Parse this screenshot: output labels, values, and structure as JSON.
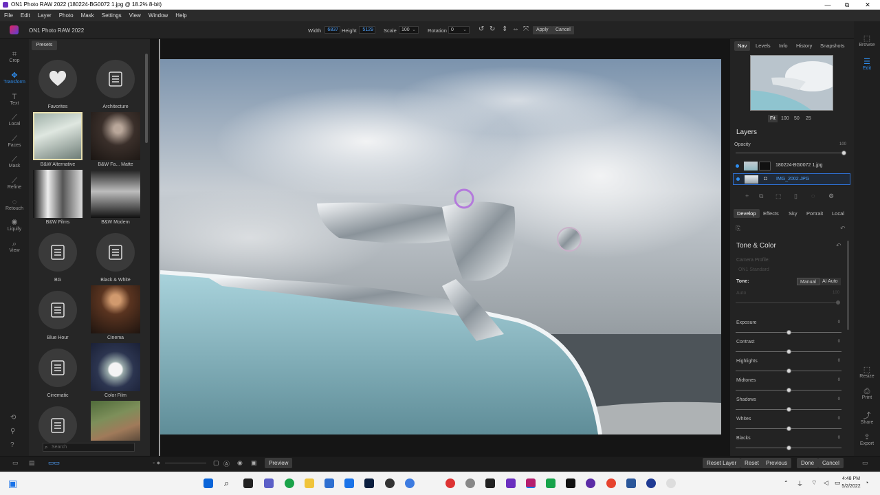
{
  "window": {
    "title": "ON1 Photo RAW 2022 (180224-BG0072 1.jpg @ 18.2% 8-bit)",
    "minimize": "—",
    "maximize": "⧉",
    "close": "✕"
  },
  "menu": [
    "File",
    "Edit",
    "Layer",
    "Photo",
    "Mask",
    "Settings",
    "View",
    "Window",
    "Help"
  ],
  "toolbar": {
    "brand": "ON1 Photo RAW 2022",
    "width_label": "Width",
    "width_value": "6837",
    "height_label": "Height",
    "height_value": "5129",
    "scale_label": "Scale",
    "scale_value": "100",
    "rotation_label": "Rotation",
    "rotation_value": "0",
    "apply": "Apply",
    "cancel": "Cancel"
  },
  "tools": [
    {
      "label": "Crop",
      "icon": "crop-icon"
    },
    {
      "label": "Transform",
      "icon": "transform-icon",
      "active": true
    },
    {
      "label": "Text",
      "icon": "text-icon"
    },
    {
      "label": "Local",
      "icon": "brush-icon"
    },
    {
      "label": "Faces",
      "icon": "faces-icon"
    },
    {
      "label": "Mask",
      "icon": "mask-icon"
    },
    {
      "label": "Refine",
      "icon": "refine-icon"
    },
    {
      "label": "Retouch",
      "icon": "retouch-icon"
    },
    {
      "label": "Liquify",
      "icon": "liquify-icon"
    },
    {
      "label": "View",
      "icon": "view-icon"
    }
  ],
  "presets": {
    "header": "Presets",
    "categories": [
      "Favorites",
      "Architecture",
      "B&W Alternative",
      "B&W Fa... Matte",
      "B&W Films",
      "B&W Modern",
      "BG",
      "Black & White",
      "Blue Hour",
      "Cinema",
      "Cinematic",
      "Color Film"
    ],
    "search_placeholder": "Search"
  },
  "bottom": {
    "preview": "Preview",
    "reset_layer": "Reset Layer",
    "reset": "Reset",
    "previous": "Previous",
    "done": "Done",
    "cancel": "Cancel"
  },
  "right": {
    "tabs": [
      "Nav",
      "Levels",
      "Info",
      "History",
      "Snapshots"
    ],
    "zoom": [
      "Fit",
      "100",
      "50",
      "25"
    ],
    "layers_title": "Layers",
    "opacity_label": "Opacity",
    "opacity_value": "100",
    "opacity_level": 1.0,
    "layers": [
      "180224-BG0072 1.jpg",
      "IMG_2002.JPG"
    ],
    "module_tabs": [
      "Develop",
      "Effects",
      "Sky",
      "Portrait",
      "Local"
    ],
    "tone_color": "Tone & Color",
    "camera_profile_label": "Camera Profile:",
    "camera_profile_value": "ON1 Standard",
    "tone_label": "Tone:",
    "tone_manual": "Manual",
    "tone_ai": "AI Auto",
    "auto_label": "Auto",
    "auto_value": "100",
    "sliders": [
      {
        "label": "Exposure",
        "value": "0"
      },
      {
        "label": "Contrast",
        "value": "0"
      },
      {
        "label": "Highlights",
        "value": "0"
      },
      {
        "label": "Midtones",
        "value": "0"
      },
      {
        "label": "Shadows",
        "value": "0"
      },
      {
        "label": "Whites",
        "value": "0"
      },
      {
        "label": "Blacks",
        "value": "0"
      }
    ]
  },
  "right_strip": [
    {
      "label": "Browse",
      "icon": "browse-icon"
    },
    {
      "label": "Edit",
      "icon": "edit-icon",
      "active": true
    },
    {
      "label": "Resize",
      "icon": "resize-icon"
    },
    {
      "label": "Print",
      "icon": "print-icon"
    },
    {
      "label": "Share",
      "icon": "share-icon"
    },
    {
      "label": "Export",
      "icon": "export-icon"
    }
  ],
  "taskbar": {
    "time": "4:48 PM",
    "date": "5/2/2022"
  },
  "colors": {
    "accent": "#2e8ef0",
    "panel": "#232323",
    "canvas": "#151515"
  }
}
